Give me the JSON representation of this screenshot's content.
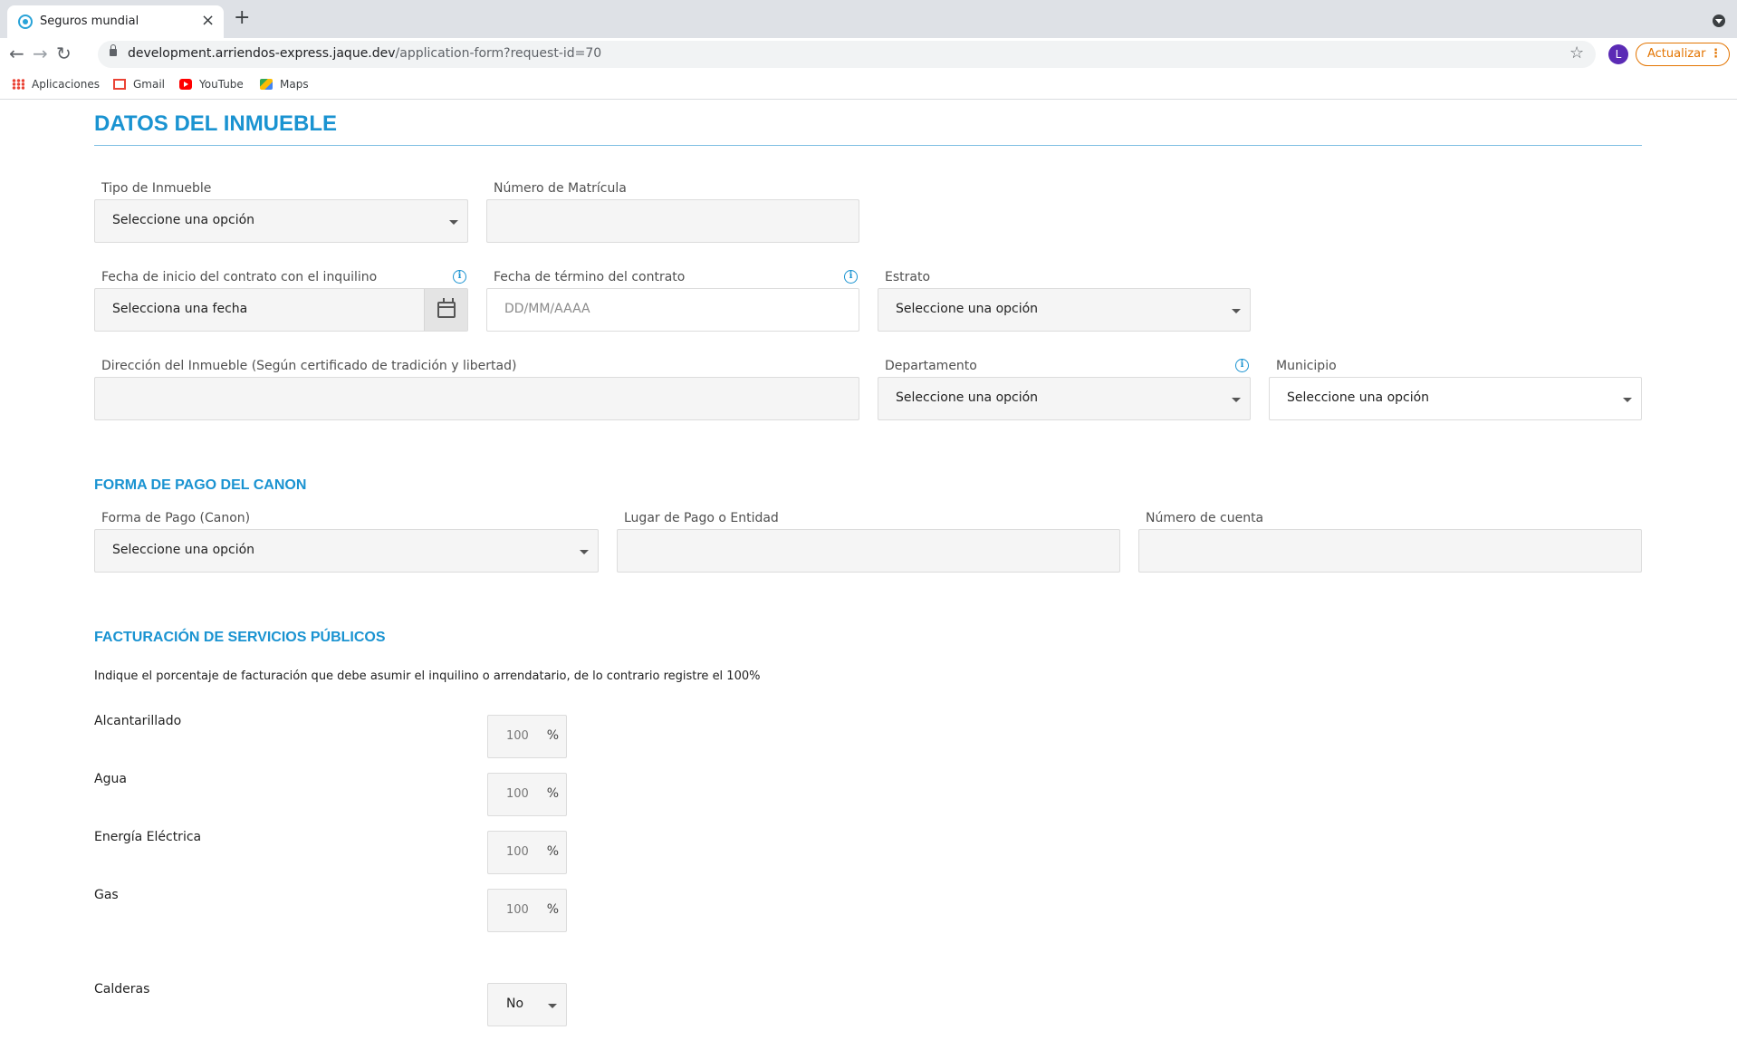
{
  "browser": {
    "tab_title": "Seguros mundial",
    "url_host": "development.arriendos-express.jaque.dev",
    "url_path": "/application-form?request-id=70",
    "avatar_letter": "L",
    "update_label": "Actualizar",
    "bookmarks": [
      "Aplicaciones",
      "Gmail",
      "YouTube",
      "Maps"
    ]
  },
  "property": {
    "title": "DATOS DEL INMUEBLE",
    "tipo_label": "Tipo de Inmueble",
    "tipo_value": "Seleccione una opción",
    "matricula_label": "Número de Matrícula",
    "matricula_value": "",
    "fecha_inicio_label": "Fecha de inicio del contrato con el inquilino",
    "fecha_inicio_value": "Selecciona una fecha",
    "fecha_fin_label": "Fecha de término del contrato",
    "fecha_fin_placeholder": "DD/MM/AAAA",
    "estrato_label": "Estrato",
    "estrato_value": "Seleccione una opción",
    "direccion_label": "Dirección del Inmueble (Según certificado de tradición y libertad)",
    "direccion_value": "",
    "departamento_label": "Departamento",
    "departamento_value": "Seleccione una opción",
    "municipio_label": "Municipio",
    "municipio_value": "Seleccione una opción"
  },
  "payment": {
    "title": "FORMA DE PAGO DEL CANON",
    "forma_label": "Forma de Pago (Canon)",
    "forma_value": "Seleccione una opción",
    "lugar_label": "Lugar de Pago o Entidad",
    "lugar_value": "",
    "cuenta_label": "Número de cuenta",
    "cuenta_value": ""
  },
  "services": {
    "title": "FACTURACIÓN DE SERVICIOS PÚBLICOS",
    "description": "Indique el porcentaje de facturación que debe asumir el inquilino o arrendatario, de lo contrario registre el 100%",
    "percent_symbol": "%",
    "items": [
      {
        "label": "Alcantarillado",
        "value": "100"
      },
      {
        "label": "Agua",
        "value": "100"
      },
      {
        "label": "Energía Eléctrica",
        "value": "100"
      },
      {
        "label": "Gas",
        "value": "100"
      }
    ],
    "calderas_label": "Calderas",
    "calderas_value": "No"
  },
  "colors": {
    "accent": "#1a93d1",
    "update": "#e37400",
    "avatar": "#5b2bb5"
  }
}
